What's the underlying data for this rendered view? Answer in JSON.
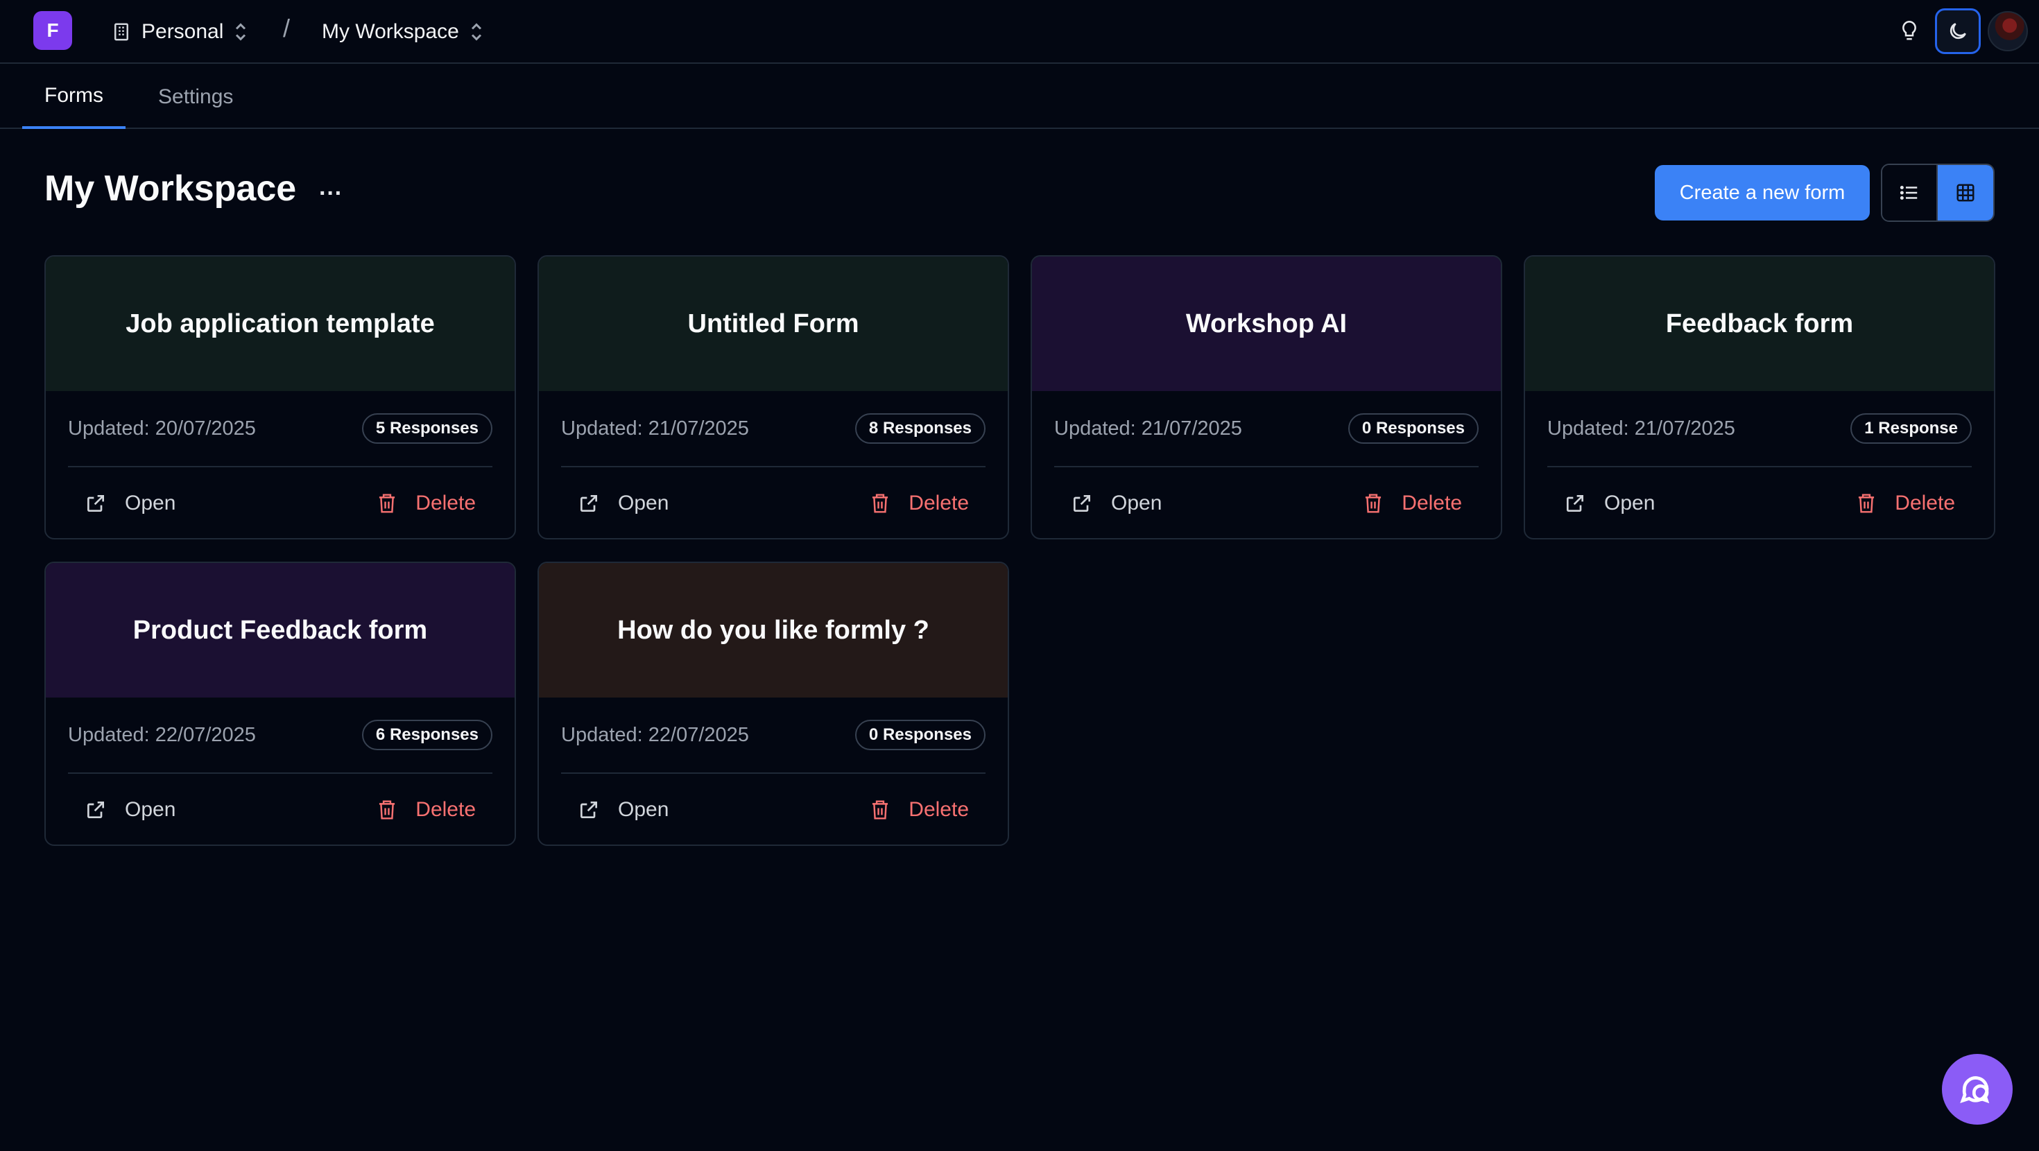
{
  "topbar": {
    "logo_letter": "F",
    "org_label": "Personal",
    "separator": "/",
    "workspace_label": "My Workspace"
  },
  "tabs": [
    {
      "label": "Forms",
      "active": true
    },
    {
      "label": "Settings",
      "active": false
    }
  ],
  "header": {
    "title": "My Workspace",
    "more_label": "···",
    "create_label": "Create a new form"
  },
  "cards": [
    {
      "title": "Job application template",
      "updated": "Updated: 20/07/2025",
      "responses": "5 Responses",
      "open": "Open",
      "delete": "Delete",
      "color": "#0f1c1c"
    },
    {
      "title": "Untitled Form",
      "updated": "Updated: 21/07/2025",
      "responses": "8 Responses",
      "open": "Open",
      "delete": "Delete",
      "color": "#0f1c1c"
    },
    {
      "title": "Workshop AI",
      "updated": "Updated: 21/07/2025",
      "responses": "0 Responses",
      "open": "Open",
      "delete": "Delete",
      "color": "#1b1032"
    },
    {
      "title": "Feedback form",
      "updated": "Updated: 21/07/2025",
      "responses": "1 Response",
      "open": "Open",
      "delete": "Delete",
      "color": "#0f1c1c"
    },
    {
      "title": "Product Feedback form",
      "updated": "Updated: 22/07/2025",
      "responses": "6 Responses",
      "open": "Open",
      "delete": "Delete",
      "color": "#1b1032"
    },
    {
      "title": "How do you like formly ?",
      "updated": "Updated: 22/07/2025",
      "responses": "0 Responses",
      "open": "Open",
      "delete": "Delete",
      "color": "#231918"
    }
  ],
  "colors": {
    "accent": "#3b82f6",
    "logo": "#7c3aed",
    "danger": "#f87171",
    "background": "#030712"
  },
  "icons": [
    "building-icon",
    "chevron-up-down-icon",
    "lightbulb-icon",
    "moon-icon",
    "list-view-icon",
    "grid-view-icon",
    "external-link-icon",
    "trash-icon",
    "chat-icon"
  ]
}
